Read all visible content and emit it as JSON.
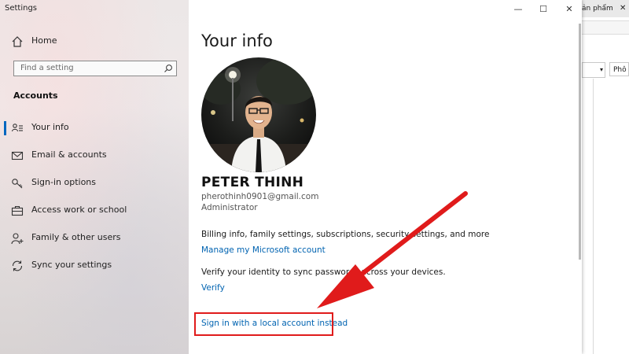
{
  "window": {
    "title": "Settings"
  },
  "controls": {
    "minimize": "—",
    "maximize": "☐",
    "close": "✕"
  },
  "background_app": {
    "tab_text": "ản phẩm",
    "tab_close": "✕",
    "dropdown_arrow": "▾",
    "button_text": "Phô"
  },
  "sidebar": {
    "home_label": "Home",
    "search_placeholder": "Find a setting",
    "section_title": "Accounts",
    "items": [
      {
        "label": "Your info",
        "icon": "person-card-icon",
        "active": true
      },
      {
        "label": "Email & accounts",
        "icon": "mail-icon",
        "active": false
      },
      {
        "label": "Sign-in options",
        "icon": "key-icon",
        "active": false
      },
      {
        "label": "Access work or school",
        "icon": "briefcase-icon",
        "active": false
      },
      {
        "label": "Family & other users",
        "icon": "person-add-icon",
        "active": false
      },
      {
        "label": "Sync your settings",
        "icon": "sync-icon",
        "active": false
      }
    ]
  },
  "main": {
    "title": "Your info",
    "user": {
      "name": "PETER THINH",
      "email": "pherothinh0901@gmail.com",
      "role": "Administrator"
    },
    "billing_text": "Billing info, family settings, subscriptions, security settings, and more",
    "manage_link": "Manage my Microsoft account",
    "verify_text": "Verify your identity to sync passwords across your devices.",
    "verify_link": "Verify",
    "local_account_link": "Sign in with a local account instead"
  },
  "annotation": {
    "color": "#e01b1b"
  },
  "colors": {
    "accent": "#0067c0",
    "link": "#0063b1"
  }
}
